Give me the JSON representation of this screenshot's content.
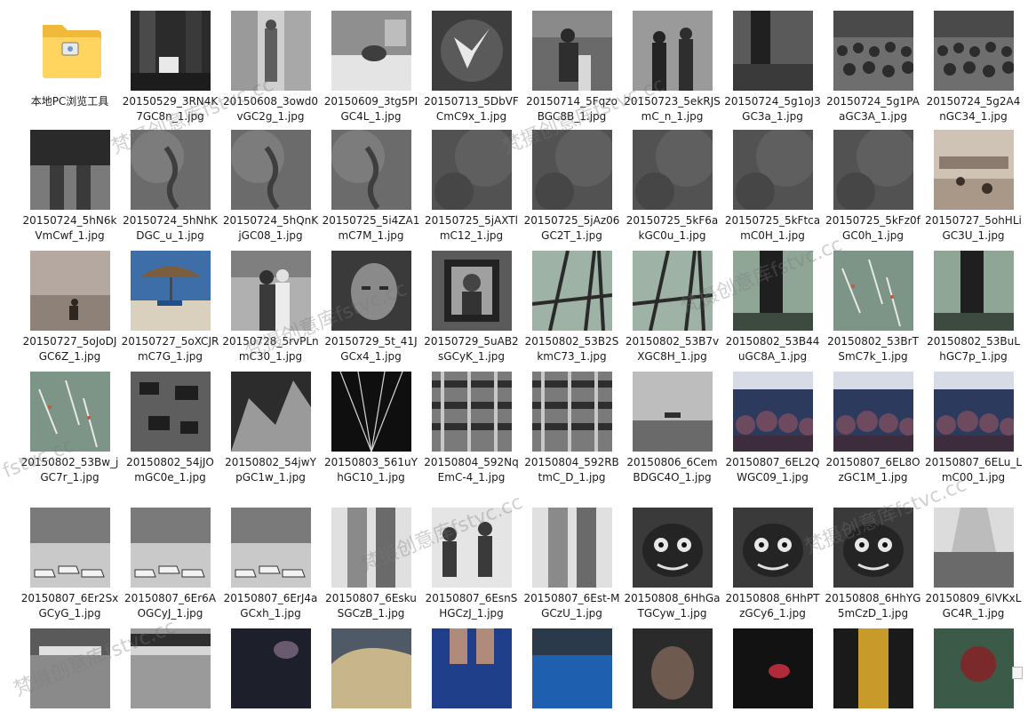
{
  "folder_item": {
    "label": "本地PC浏览工具",
    "icon": "folder-icon"
  },
  "files": [
    {
      "name": "20150529_3RN4K7GC8n_1.jpg",
      "thumb": "dark-room-tv"
    },
    {
      "name": "20150608_3owd0vGC2g_1.jpg",
      "thumb": "doorway-figure"
    },
    {
      "name": "20150609_3tg5PIGC4L_1.jpg",
      "thumb": "bed-scene"
    },
    {
      "name": "20150713_5DbVFCmC9x_1.jpg",
      "thumb": "bird-flight"
    },
    {
      "name": "20150714_5FqzoBGC8B_1.jpg",
      "thumb": "people-dark"
    },
    {
      "name": "20150723_5ekRJSmC_n_1.jpg",
      "thumb": "silhouettes"
    },
    {
      "name": "20150724_5g1oJ3GC3a_1.jpg",
      "thumb": "crowd-dark"
    },
    {
      "name": "20150724_5g1PAaGC3A_1.jpg",
      "thumb": "crowd"
    },
    {
      "name": "20150724_5g2A4nGC34_1.jpg",
      "thumb": "crowd"
    },
    {
      "name": "20150724_5hN6kVmCwf_1.jpg",
      "thumb": "legs-dark"
    },
    {
      "name": "20150724_5hNhKDGC_u_1.jpg",
      "thumb": "texture-gray"
    },
    {
      "name": "20150724_5hQnKjGC08_1.jpg",
      "thumb": "texture-gray"
    },
    {
      "name": "20150725_5i4ZA1mC7M_1.jpg",
      "thumb": "texture-gray"
    },
    {
      "name": "20150725_5jAXTlmC12_1.jpg",
      "thumb": "texture-dark"
    },
    {
      "name": "20150725_5jAz06GC2T_1.jpg",
      "thumb": "texture-dark"
    },
    {
      "name": "20150725_5kF6akGC0u_1.jpg",
      "thumb": "texture-dark"
    },
    {
      "name": "20150725_5kFtcamC0H_1.jpg",
      "thumb": "texture-dark"
    },
    {
      "name": "20150725_5kFz0fGC0h_1.jpg",
      "thumb": "texture-dark"
    },
    {
      "name": "20150727_5ohHLiGC3U_1.jpg",
      "thumb": "beach-sepia"
    },
    {
      "name": "20150727_5oJoDJGC6Z_1.jpg",
      "thumb": "beach-sepia2"
    },
    {
      "name": "20150727_5oXCJRmC7G_1.jpg",
      "thumb": "umbrella"
    },
    {
      "name": "20150728_5rvPLnmC30_1.jpg",
      "thumb": "couple-bw"
    },
    {
      "name": "20150729_5t_41JGCx4_1.jpg",
      "thumb": "face-closeup"
    },
    {
      "name": "20150729_5uAB2sGCyK_1.jpg",
      "thumb": "frame-portrait"
    },
    {
      "name": "20150802_53B2SkmC73_1.jpg",
      "thumb": "green-bars"
    },
    {
      "name": "20150802_53B7vXGC8H_1.jpg",
      "thumb": "green-bars"
    },
    {
      "name": "20150802_53B44uGC8A_1.jpg",
      "thumb": "green-dark"
    },
    {
      "name": "20150802_53BrTSmC7k_1.jpg",
      "thumb": "green-streaks"
    },
    {
      "name": "20150802_53BuLhGC7p_1.jpg",
      "thumb": "green-dark"
    },
    {
      "name": "20150802_53Bw_jGC7r_1.jpg",
      "thumb": "green-streaks"
    },
    {
      "name": "20150802_54jJOmGC0e_1.jpg",
      "thumb": "cameras-table"
    },
    {
      "name": "20150802_54jwYpGC1w_1.jpg",
      "thumb": "rock-slope"
    },
    {
      "name": "20150803_561uYhGC10_1.jpg",
      "thumb": "light-rays"
    },
    {
      "name": "20150804_592NqEmC-4_1.jpg",
      "thumb": "stripes"
    },
    {
      "name": "20150804_592RBtmC_D_1.jpg",
      "thumb": "stripes"
    },
    {
      "name": "20150806_6CemBDGC4O_1.jpg",
      "thumb": "runway"
    },
    {
      "name": "20150807_6EL2QWGC09_1.jpg",
      "thumb": "masks-hall"
    },
    {
      "name": "20150807_6EL8OzGC1M_1.jpg",
      "thumb": "masks-hall"
    },
    {
      "name": "20150807_6ELu_LmC00_1.jpg",
      "thumb": "masks-hall"
    },
    {
      "name": "20150807_6Er2SxGCyG_1.jpg",
      "thumb": "heels-row"
    },
    {
      "name": "20150807_6Er6AOGCyJ_1.jpg",
      "thumb": "heels-row"
    },
    {
      "name": "20150807_6ErJ4aGCxh_1.jpg",
      "thumb": "heels-row"
    },
    {
      "name": "20150807_6EskuSGCzB_1.jpg",
      "thumb": "legs-bw"
    },
    {
      "name": "20150807_6EsnSHGCzJ_1.jpg",
      "thumb": "parade-bw"
    },
    {
      "name": "20150807_6Est-MGCzU_1.jpg",
      "thumb": "legs-bw"
    },
    {
      "name": "20150808_6HhGaTGCyw_1.jpg",
      "thumb": "demon-masks"
    },
    {
      "name": "20150808_6HhPTzGCy6_1.jpg",
      "thumb": "demon-masks"
    },
    {
      "name": "20150808_6HhYG5mCzD_1.jpg",
      "thumb": "demon-masks"
    },
    {
      "name": "20150809_6lVKxLGC4R_1.jpg",
      "thumb": "street-crowd"
    },
    {
      "name": "",
      "thumb": "street-bw"
    },
    {
      "name": "",
      "thumb": "awning-bw"
    },
    {
      "name": "",
      "thumb": "hand-dark"
    },
    {
      "name": "",
      "thumb": "blonde-hair"
    },
    {
      "name": "",
      "thumb": "blue-legs"
    },
    {
      "name": "",
      "thumb": "blue-dress"
    },
    {
      "name": "",
      "thumb": "portrait-dark"
    },
    {
      "name": "",
      "thumb": "red-hand"
    },
    {
      "name": "",
      "thumb": "gold-statue"
    },
    {
      "name": "",
      "thumb": "red-green"
    }
  ],
  "watermarks": [
    "梵摄创意库fstvc.cc",
    "梵摄创意库fstvc.cc",
    "梵摄创意库fstvc.cc",
    "梵摄创意库fstvc.cc",
    "梵摄创意库fstvc.cc",
    "梵摄创意库fstvc.cc",
    "梵摄创意库fstvc.cc",
    "fstvc.cc"
  ]
}
